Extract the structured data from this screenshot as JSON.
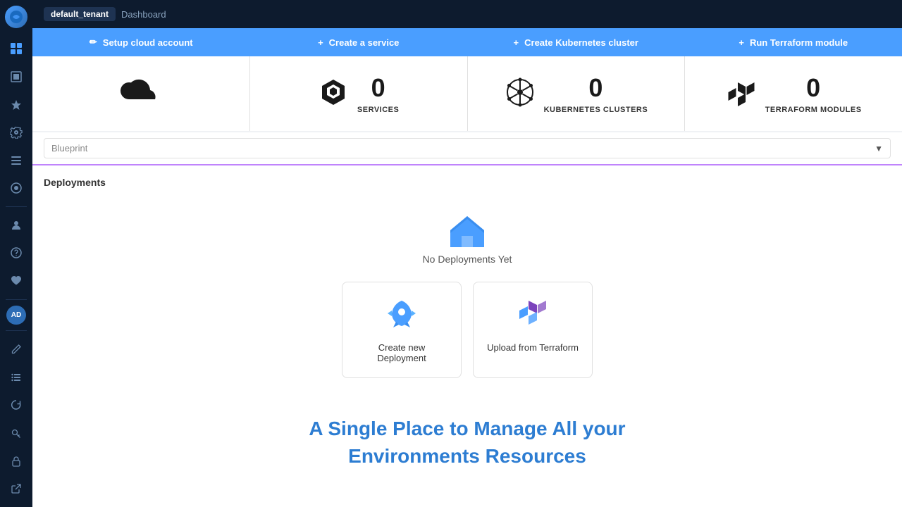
{
  "topbar": {
    "tenant": "default_tenant",
    "breadcrumb": "Dashboard"
  },
  "action_buttons": [
    {
      "id": "setup-cloud",
      "label": "Setup cloud account",
      "icon": "✏️"
    },
    {
      "id": "create-service",
      "label": "Create a service",
      "icon": "+"
    },
    {
      "id": "create-k8s",
      "label": "Create Kubernetes cluster",
      "icon": "+"
    },
    {
      "id": "run-terraform",
      "label": "Run Terraform module",
      "icon": "+"
    }
  ],
  "stats": [
    {
      "id": "cloud-accounts",
      "icon": "cloud",
      "count": null,
      "label": null
    },
    {
      "id": "services",
      "icon": "box",
      "count": "0",
      "label": "SERVICES"
    },
    {
      "id": "k8s-clusters",
      "icon": "k8s",
      "count": "0",
      "label": "KUBERNETES CLUSTERS"
    },
    {
      "id": "terraform-modules",
      "icon": "terraform",
      "count": "0",
      "label": "TERRAFORM MODULES"
    }
  ],
  "blueprint": {
    "placeholder": "Blueprint",
    "arrow": "▼"
  },
  "deployments": {
    "title": "Deployments",
    "empty_text": "No Deployments Yet",
    "cards": [
      {
        "id": "create-deployment",
        "label": "Create new Deployment",
        "icon": "rocket"
      },
      {
        "id": "upload-terraform",
        "label": "Upload from Terraform",
        "icon": "terraform"
      }
    ]
  },
  "hero": {
    "line1": "A Single Place to Manage All your",
    "line2": "Environments Resources"
  },
  "sidebar": {
    "logo": "☁",
    "items": [
      {
        "id": "home",
        "icon": "⊞",
        "active": false
      },
      {
        "id": "pages",
        "icon": "❑",
        "active": false
      },
      {
        "id": "rocket",
        "icon": "🚀",
        "active": false
      },
      {
        "id": "settings-gear",
        "icon": "⚙",
        "active": false
      },
      {
        "id": "list",
        "icon": "☰",
        "active": false
      },
      {
        "id": "gear2",
        "icon": "◈",
        "active": false
      }
    ],
    "bottom_items": [
      {
        "id": "user",
        "icon": "👤"
      },
      {
        "id": "help",
        "icon": "?"
      },
      {
        "id": "health",
        "icon": "♥"
      }
    ],
    "avatar": "AD",
    "bottom2": [
      {
        "id": "edit",
        "icon": "✎"
      },
      {
        "id": "bullet-list",
        "icon": "≡"
      },
      {
        "id": "refresh",
        "icon": "↺"
      },
      {
        "id": "key",
        "icon": "🔑"
      },
      {
        "id": "lock",
        "icon": "🔒"
      },
      {
        "id": "external",
        "icon": "↗"
      }
    ]
  }
}
